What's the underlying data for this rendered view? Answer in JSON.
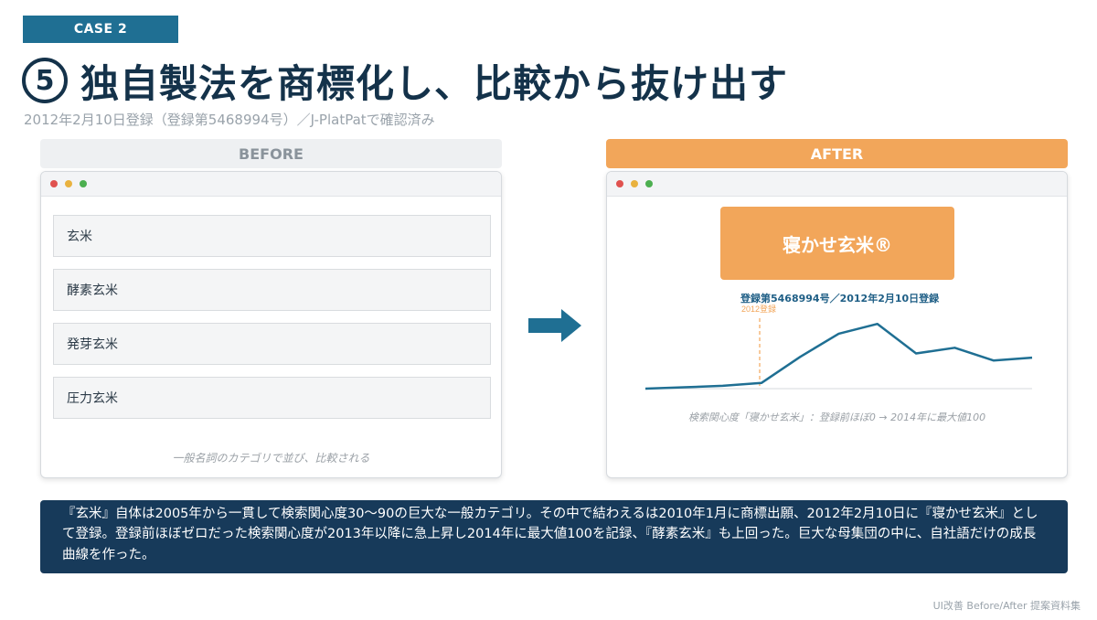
{
  "case_tag": "CASE 2",
  "title": {
    "number": "5",
    "text": "独自製法を商標化し、比較から抜け出す"
  },
  "subtitle": "2012年2月10日登録（登録第5468994号）／J-PlatPatで確認済み",
  "before": {
    "label": "BEFORE",
    "items": [
      "玄米",
      "酵素玄米",
      "発芽玄米",
      "圧力玄米"
    ],
    "note": "一般名詞のカテゴリで並び、比較される"
  },
  "after": {
    "label": "AFTER",
    "brand": "寝かせ玄米®",
    "registration": "登録第5468994号／2012年2月10日登録",
    "marker_label": "2012登録",
    "note": "検索関心度「寝かせ玄米」：登録前ほぼ0 → 2014年に最大値100",
    "chart_data": {
      "type": "line",
      "series": [
        {
          "values": [
            0,
            2,
            4,
            8,
            45,
            78,
            92,
            50,
            58,
            40,
            44
          ]
        }
      ],
      "marker": "2012登録",
      "ylim": [
        0,
        100
      ]
    }
  },
  "summary": "『玄米』自体は2005年から一貫して検索関心度30〜90の巨大な一般カテゴリ。その中で結わえるは2010年1月に商標出願、2012年2月10日に『寝かせ玄米』として登録。登録前ほぼゼロだった検索関心度が2013年以降に急上昇し2014年に最大値100を記録、『酵素玄米』も上回った。巨大な母集団の中に、自社語だけの成長曲線を作った。",
  "footer": "UI改善 Before/After 提案資料集",
  "colors": {
    "accent": "#1f6f93",
    "navy": "#173a5a",
    "orange": "#f2a65a",
    "dot_red": "#e0524f",
    "dot_yellow": "#e9b23f",
    "dot_green": "#4caf50"
  }
}
